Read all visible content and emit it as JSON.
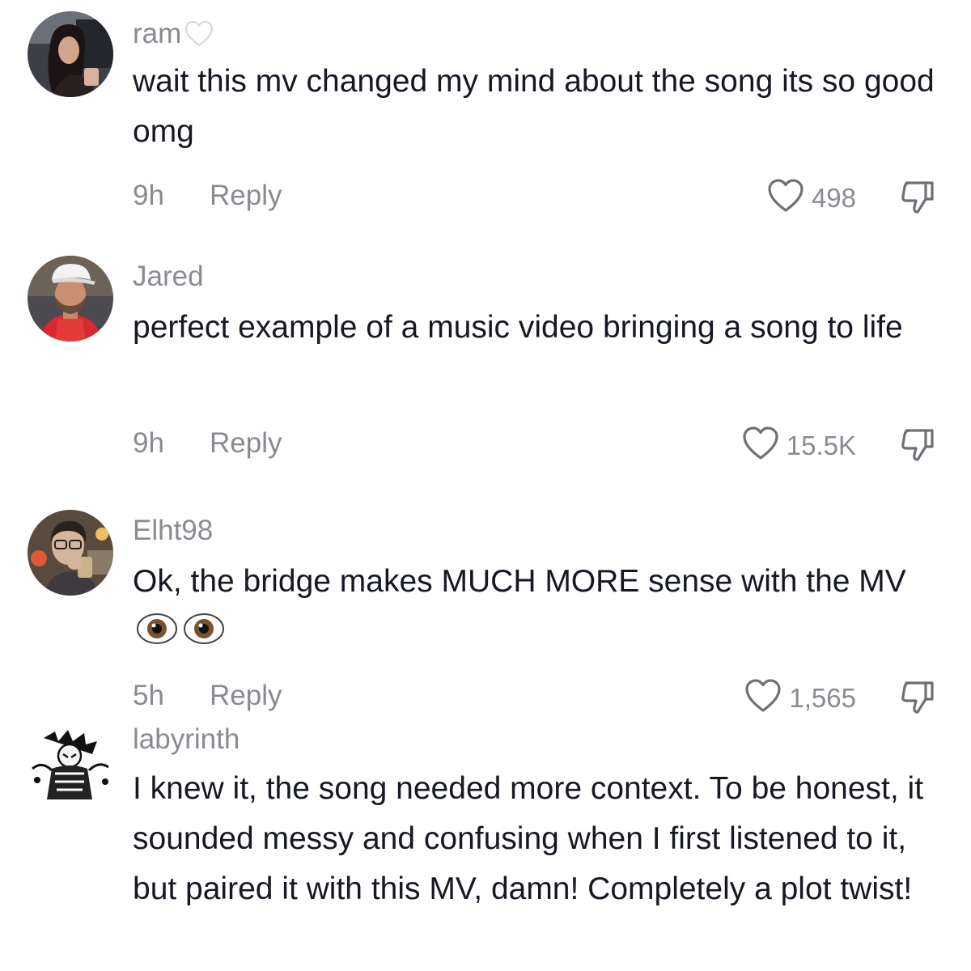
{
  "comments": [
    {
      "username": "ram",
      "username_badge_icon": "white-heart-icon",
      "text": "wait this mv changed my mind about the song its so good omg",
      "time": "9h",
      "reply_label": "Reply",
      "likes": "498",
      "avatar": "user-avatar-woman"
    },
    {
      "username": "Jared",
      "text": "perfect example of a music video bringing a song to life",
      "time": "9h",
      "reply_label": "Reply",
      "likes": "15.5K",
      "avatar": "user-avatar-man-cap"
    },
    {
      "username": "Elht98",
      "text": "Ok, the bridge makes MUCH MORE sense with the MV",
      "text_emoji": "eyes-emoji",
      "time": "5h",
      "reply_label": "Reply",
      "likes": "1,565",
      "avatar": "user-avatar-glasses"
    },
    {
      "username": "labyrinth",
      "text": "I knew it, the song needed more context. To be honest, it sounded messy and confusing when I first listened to it, but paired it with this MV, damn! Completely a plot twist!",
      "avatar": "user-avatar-manga"
    }
  ],
  "icons": {
    "like": "heart-outline-icon",
    "dislike": "thumbs-down-icon"
  },
  "colors": {
    "primary_text": "#161823",
    "secondary_text": "#8a8b91",
    "background": "#ffffff"
  }
}
